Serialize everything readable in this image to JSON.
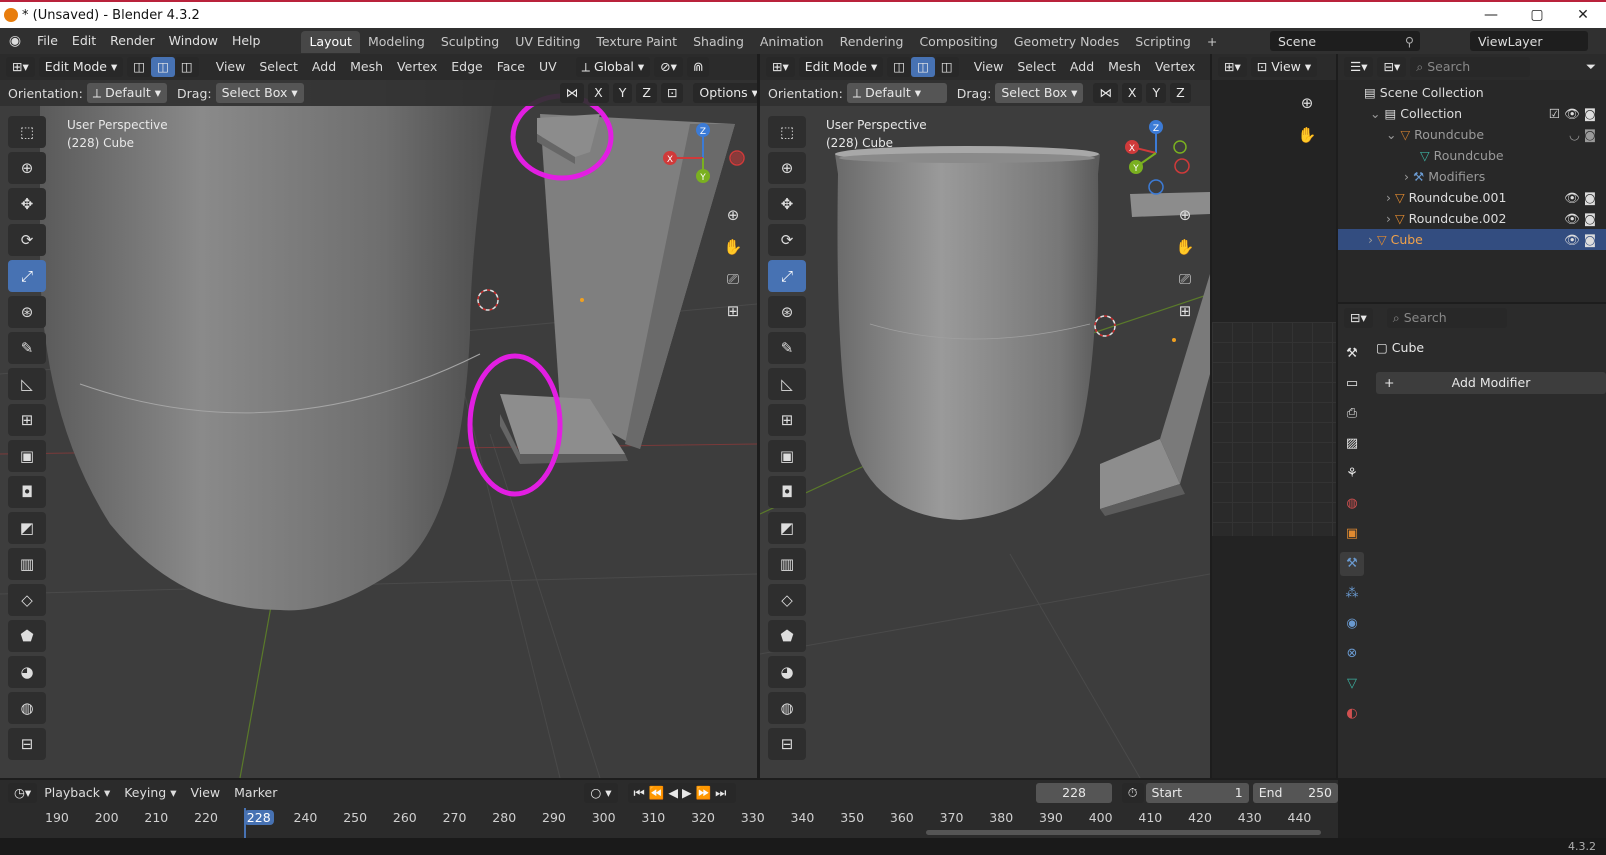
{
  "window": {
    "title": "* (Unsaved) - Blender 4.3.2",
    "controls": [
      "—",
      "▢",
      "✕"
    ]
  },
  "menu": [
    "File",
    "Edit",
    "Render",
    "Window",
    "Help"
  ],
  "workspaces": [
    "Layout",
    "Modeling",
    "Sculpting",
    "UV Editing",
    "Texture Paint",
    "Shading",
    "Animation",
    "Rendering",
    "Compositing",
    "Geometry Nodes",
    "Scripting"
  ],
  "scene": {
    "name": "Scene",
    "view_layer": "ViewLayer"
  },
  "viewport_left": {
    "mode": "Edit Mode",
    "menus": [
      "View",
      "Select",
      "Add",
      "Mesh",
      "Vertex",
      "Edge",
      "Face",
      "UV"
    ],
    "transform": "Global",
    "orientation_label": "Orientation:",
    "orientation": "Default",
    "drag_label": "Drag:",
    "drag": "Select Box",
    "axes": [
      "X",
      "Y",
      "Z"
    ],
    "options": "Options",
    "perspective": "User Perspective",
    "object": "(228) Cube"
  },
  "viewport_right": {
    "mode": "Edit Mode",
    "menus": [
      "View",
      "Select",
      "Add",
      "Mesh",
      "Vertex"
    ],
    "orientation_label": "Orientation:",
    "orientation": "Default",
    "drag_label": "Drag:",
    "drag": "Select Box",
    "axes": [
      "X",
      "Y",
      "Z"
    ],
    "perspective": "User Perspective",
    "object": "(228) Cube"
  },
  "gizmo": {
    "x": "X",
    "y": "Y",
    "z": "Z"
  },
  "small_view": {
    "menu": "View"
  },
  "outliner": {
    "search_placeholder": "Search",
    "rows": [
      "Scene Collection",
      "Collection",
      "Roundcube",
      "Roundcube",
      "Modifiers",
      "Roundcube.001",
      "Roundcube.002",
      "Cube"
    ]
  },
  "properties": {
    "search_placeholder": "Search",
    "object": "Cube",
    "add_modifier": "Add Modifier"
  },
  "timeline": {
    "menus": [
      "Playback",
      "Keying",
      "View",
      "Marker"
    ],
    "current_frame": "228",
    "start_label": "Start",
    "start": "1",
    "end_label": "End",
    "end": "250",
    "ticks": [
      "190",
      "200",
      "210",
      "220",
      "228",
      "240",
      "250",
      "260",
      "270",
      "280",
      "290",
      "300",
      "310",
      "320",
      "330",
      "340",
      "350",
      "360",
      "370",
      "380",
      "390",
      "400",
      "410",
      "420",
      "430",
      "440"
    ]
  },
  "status": {
    "version": "4.3.2"
  },
  "colors": {
    "accent": "#4772b3",
    "highlight_circle": "#e21ee2",
    "selected_text": "#f0a24a"
  }
}
